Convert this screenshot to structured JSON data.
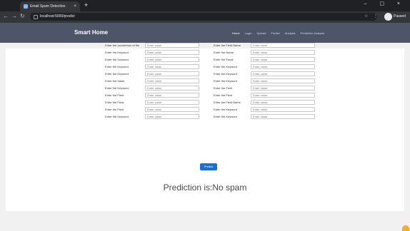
{
  "browser": {
    "tab_title": "Email Spam Detection",
    "tab_close": "×",
    "new_tab": "+",
    "window_controls": "– ▢ ×",
    "url": "localhost:5000/predict",
    "profile_name": "Paused"
  },
  "navbar": {
    "brand": "Smart Home",
    "links": [
      "Home",
      "Login",
      "Upload",
      "Predict",
      "Analysis",
      "Prediction Analysis"
    ]
  },
  "form": {
    "rows": [
      {
        "label1": "Enter the occurrence of the",
        "value1": "Enter value",
        "label2": "Enter the Field Name",
        "value2": "Enter value"
      },
      {
        "label1": "Enter the Keyword",
        "value1": "Enter value",
        "label2": "Enter the Name",
        "value2": "Enter value"
      },
      {
        "label1": "Enter the Keyword",
        "value1": "Enter value",
        "label2": "Enter the Email",
        "value2": "Enter value"
      },
      {
        "label1": "Enter the Keyword",
        "value1": "Enter value",
        "label2": "Enter the Keyword",
        "value2": "Enter value"
      },
      {
        "label1": "Enter the Keyword",
        "value1": "Enter value",
        "label2": "Enter the Keyword",
        "value2": "Enter value"
      },
      {
        "label1": "Enter the Value",
        "value1": "Enter value",
        "label2": "Enter the Keyword",
        "value2": "Enter value"
      },
      {
        "label1": "Enter the Keyword",
        "value1": "Enter value",
        "label2": "Enter the Field",
        "value2": "Enter value"
      },
      {
        "label1": "Enter the Field",
        "value1": "Enter value",
        "label2": "Enter the Field",
        "value2": "Enter value"
      },
      {
        "label1": "Enter the Field",
        "value1": "Enter value",
        "label2": "Enter the Field Name",
        "value2": "Enter value"
      },
      {
        "label1": "Enter the Field",
        "value1": "Enter value",
        "label2": "Enter the Keyword",
        "value2": "Enter value"
      },
      {
        "label1": "Enter the Keyword",
        "value1": "Enter value",
        "label2": "Enter the Keyword",
        "value2": "Enter value"
      }
    ]
  },
  "predict_button": "Predict",
  "result": "Prediction is:No spam",
  "colors": {
    "navbar_bg": "#4d5569",
    "button_bg": "#1d6fd7",
    "browser_dark": "#202124"
  }
}
